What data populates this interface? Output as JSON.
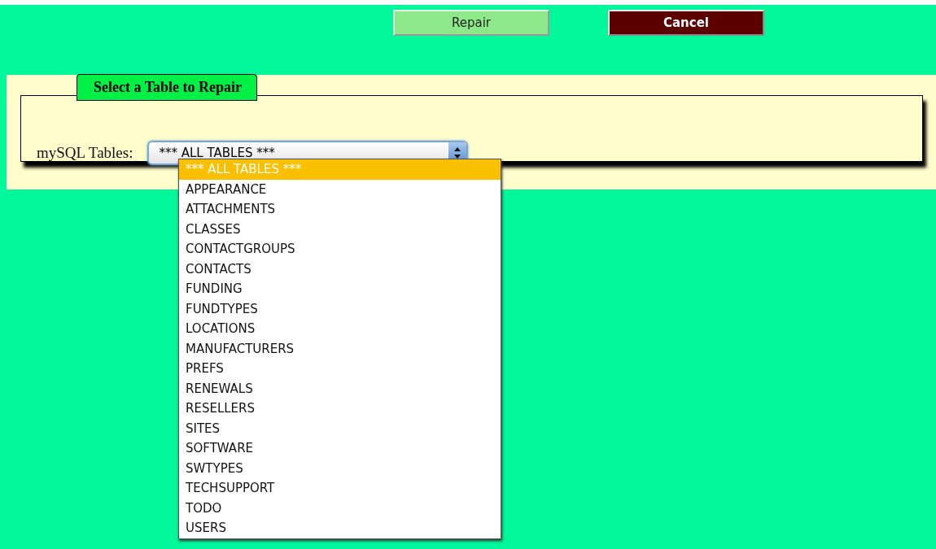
{
  "buttons": [
    {
      "label": "Repair",
      "kind": "primary"
    },
    {
      "label": "Cancel",
      "kind": "danger"
    }
  ],
  "fieldset": {
    "legend": "Select a Table to Repair",
    "label": "mySQL Tables:",
    "select": {
      "value": "*** ALL TABLES ***",
      "expanded": true
    }
  },
  "options": [
    {
      "label": "*** ALL TABLES ***",
      "selected": true
    },
    {
      "label": "APPEARANCE",
      "selected": false
    },
    {
      "label": "ATTACHMENTS",
      "selected": false
    },
    {
      "label": "CLASSES",
      "selected": false
    },
    {
      "label": "CONTACTGROUPS",
      "selected": false
    },
    {
      "label": "CONTACTS",
      "selected": false
    },
    {
      "label": "FUNDING",
      "selected": false
    },
    {
      "label": "FUNDTYPES",
      "selected": false
    },
    {
      "label": "LOCATIONS",
      "selected": false
    },
    {
      "label": "MANUFACTURERS",
      "selected": false
    },
    {
      "label": "PREFS",
      "selected": false
    },
    {
      "label": "RENEWALS",
      "selected": false
    },
    {
      "label": "RESELLERS",
      "selected": false
    },
    {
      "label": "SITES",
      "selected": false
    },
    {
      "label": "SOFTWARE",
      "selected": false
    },
    {
      "label": "SWTYPES",
      "selected": false
    },
    {
      "label": "TECHSUPPORT",
      "selected": false
    },
    {
      "label": "TODO",
      "selected": false
    },
    {
      "label": "USERS",
      "selected": false
    }
  ]
}
